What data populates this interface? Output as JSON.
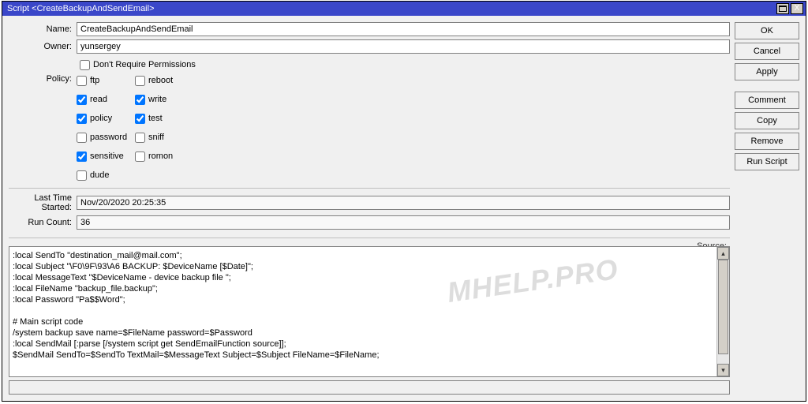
{
  "titlebar": {
    "text": "Script <CreateBackupAndSendEmail>"
  },
  "tb_buttons": {
    "close_glyph": "X"
  },
  "form": {
    "name_label": "Name:",
    "name_value": "CreateBackupAndSendEmail",
    "owner_label": "Owner:",
    "owner_value": "yunsergey",
    "dont_require_perms_label": "Don't Require Permissions",
    "policy_label": "Policy:",
    "policies_col1": [
      {
        "key": "ftp",
        "label": "ftp",
        "checked": false
      },
      {
        "key": "read",
        "label": "read",
        "checked": true
      },
      {
        "key": "policy",
        "label": "policy",
        "checked": true
      },
      {
        "key": "password",
        "label": "password",
        "checked": false
      },
      {
        "key": "sensitive",
        "label": "sensitive",
        "checked": true
      },
      {
        "key": "dude",
        "label": "dude",
        "checked": false
      }
    ],
    "policies_col2": [
      {
        "key": "reboot",
        "label": "reboot",
        "checked": false
      },
      {
        "key": "write",
        "label": "write",
        "checked": true
      },
      {
        "key": "test",
        "label": "test",
        "checked": true
      },
      {
        "key": "sniff",
        "label": "sniff",
        "checked": false
      },
      {
        "key": "romon",
        "label": "romon",
        "checked": false
      }
    ],
    "last_time_label": "Last Time Started:",
    "last_time_value": "Nov/20/2020 20:25:35",
    "run_count_label": "Run Count:",
    "run_count_value": "36",
    "source_label": "Source:",
    "source_text": ":local SendTo \"destination_mail@mail.com\";\n:local Subject \"\\F0\\9F\\93\\A6 BACKUP: $DeviceName [$Date]\";\n:local MessageText \"$DeviceName - device backup file \";\n:local FileName \"backup_file.backup\";\n:local Password \"Pa$$Word\";\n\n# Main script code\n/system backup save name=$FileName password=$Password\n:local SendMail [:parse [/system script get SendEmailFunction source]];\n$SendMail SendTo=$SendTo TextMail=$MessageText Subject=$Subject FileName=$FileName;"
  },
  "buttons": {
    "ok": "OK",
    "cancel": "Cancel",
    "apply": "Apply",
    "comment": "Comment",
    "copy": "Copy",
    "remove": "Remove",
    "run": "Run Script"
  },
  "watermark": "MHELP.PRO"
}
